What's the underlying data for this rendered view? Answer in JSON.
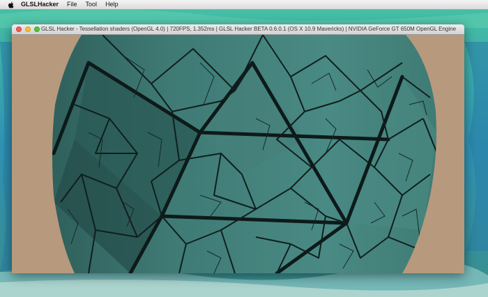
{
  "menubar": {
    "app_name": "GLSLHacker",
    "items": [
      {
        "label": "File"
      },
      {
        "label": "Tool"
      },
      {
        "label": "Help"
      }
    ]
  },
  "window": {
    "title": "GLSL Hacker - Tessellation shaders (OpenGL 4.0) | 720FPS, 1.352ms | GLSL Hacker BETA 0.6.0.1 (OS X 10.9 Mavericks) | NVIDIA GeForce GT 650M OpenGL Engine",
    "background_color": "#b79a7e",
    "mesh_color": "#3e7a74"
  },
  "desktop": {
    "wallpaper": "ocean-wave"
  }
}
